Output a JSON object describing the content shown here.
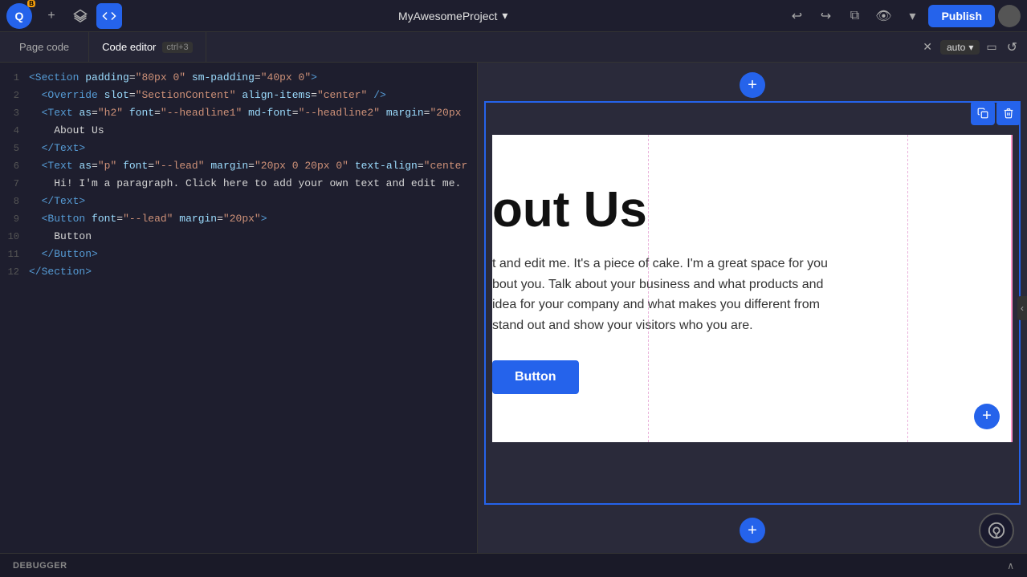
{
  "app": {
    "logo_letter": "Q",
    "beta_label": "B"
  },
  "toolbar": {
    "project_name": "MyAwesomeProject",
    "publish_label": "Publish",
    "undo_icon": "↩",
    "redo_icon": "↪",
    "external_icon": "⧉",
    "eye_icon": "👁",
    "chevron_icon": "▾",
    "add_icon": "+"
  },
  "tabs": {
    "page_code_label": "Page code",
    "code_editor_label": "Code editor",
    "shortcut_label": "ctrl+3"
  },
  "preview_controls": {
    "close_icon": "✕",
    "auto_label": "auto",
    "chevron_icon": "▾",
    "device_icon": "▭",
    "refresh_icon": "↺"
  },
  "code_lines": [
    {
      "num": 1,
      "code": "<Section padding=\"80px 0\" sm-padding=\"40px 0\">",
      "selected": false
    },
    {
      "num": 2,
      "code": "  <Override slot=\"SectionContent\" align-items=\"center\" />",
      "selected": false
    },
    {
      "num": 3,
      "code": "  <Text as=\"h2\" font=\"--headline1\" md-font=\"--headline2\" margin=\"20px...",
      "selected": false
    },
    {
      "num": 4,
      "code": "    About Us",
      "selected": false
    },
    {
      "num": 5,
      "code": "  </Text>",
      "selected": false
    },
    {
      "num": 6,
      "code": "  <Text as=\"p\" font=\"--lead\" margin=\"20px 0 20px 0\" text-align=\"center...",
      "selected": false
    },
    {
      "num": 7,
      "code": "    Hi! I'm a paragraph. Click here to add your own text and edit me.",
      "selected": false
    },
    {
      "num": 8,
      "code": "  </Text>",
      "selected": false
    },
    {
      "num": 9,
      "code": "  <Button font=\"--lead\" margin=\"20px\">",
      "selected": false
    },
    {
      "num": 10,
      "code": "    Button",
      "selected": false
    },
    {
      "num": 11,
      "code": "  </Button>",
      "selected": false
    },
    {
      "num": 12,
      "code": "</Section>",
      "selected": false
    }
  ],
  "preview": {
    "heading": "out Us",
    "paragraph_1": "t and edit me. It's a piece of cake. I'm a great space for you",
    "paragraph_2": "bout you. Talk about your business and what products and",
    "paragraph_3": "idea for your company and what makes you different from",
    "paragraph_4": "stand out and show your visitors who you are.",
    "cta_label": "Button",
    "add_icon": "+",
    "copy_icon": "⧉",
    "delete_icon": "🗑"
  },
  "debugger": {
    "label": "DEBUGGER",
    "chevron_icon": "∧"
  }
}
